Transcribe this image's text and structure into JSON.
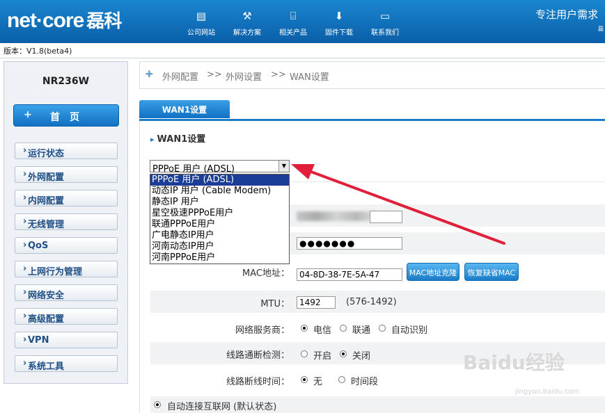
{
  "header": {
    "logo": "net·core",
    "logo_cn": "磊科",
    "slogan": "专注用户需求",
    "slogan2": "磊",
    "nav": [
      {
        "label": "公司网站",
        "icon": "website-icon"
      },
      {
        "label": "解决方案",
        "icon": "tools-icon"
      },
      {
        "label": "相关产品",
        "icon": "router-icon"
      },
      {
        "label": "固件下载",
        "icon": "download-icon"
      },
      {
        "label": "联系我们",
        "icon": "chat-icon"
      }
    ]
  },
  "version": "版本：V1.8(beta4)",
  "sidebar": {
    "model": "NR236W",
    "home_plus": "+",
    "home": "首页",
    "items": [
      "运行状态",
      "外网配置",
      "内网配置",
      "无线管理",
      "QoS",
      "上网行为管理",
      "网络安全",
      "高级配置",
      "VPN",
      "系统工具"
    ]
  },
  "breadcrumb": {
    "c1": "外网配置",
    "sep": ">>",
    "c2": "外网设置",
    "c3": "WAN设置"
  },
  "tab": "WAN1设置",
  "section_title": "WAN1设置",
  "wan_type": {
    "selected": "PPPoE 用户 (ADSL)",
    "options": [
      "PPPoE 用户 (ADSL)",
      "动态IP 用户 (Cable Modem)",
      "静态IP 用户",
      "星空极速PPPoE用户",
      "联通PPPoE用户",
      "广电静态IP用户",
      "河南动态IP用户",
      "河南PPPoE用户"
    ]
  },
  "fields": {
    "account_label": "址：",
    "password_label": "址：",
    "password": "●●●●●●●",
    "mac_label": "MAC地址：",
    "mac": "04-8D-38-7E-5A-47",
    "mac_clone": "MAC地址克隆",
    "mac_restore": "恢复缺省MAC",
    "mtu_label": "MTU：",
    "mtu": "1492",
    "mtu_range": "(576-1492)",
    "isp_label": "网络服务商：",
    "isp_opts": [
      "电信",
      "联通",
      "自动识别"
    ],
    "detect_label": "线路通断检测：",
    "detect_opts": [
      "开启",
      "关闭"
    ],
    "disconnect_label": "线路断线时间：",
    "disconnect_opts": [
      "无",
      "时间段"
    ],
    "auto_connect": "自动连接互联网 (默认状态)"
  },
  "watermark": "Baidu经验",
  "watermark2": "jingyan.baidu.com",
  "colors": {
    "header": "#1a86d0",
    "accent": "#1a7cc8",
    "arrow": "#e0203a",
    "dropdown_selected": "#1c3d96"
  }
}
